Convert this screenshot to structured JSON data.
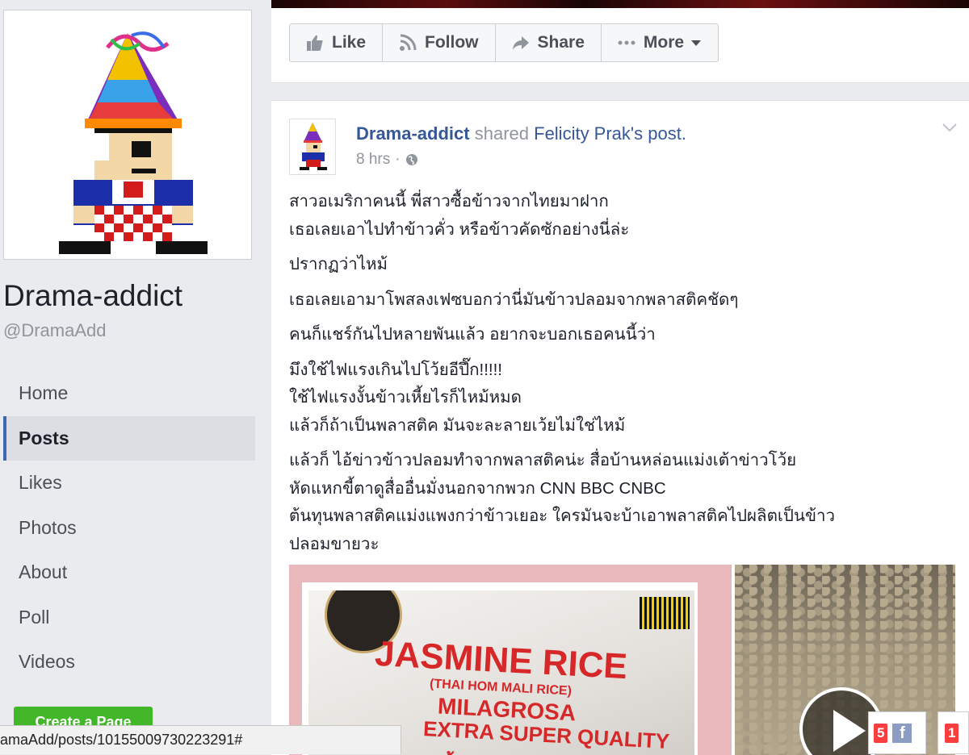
{
  "page": {
    "name": "Drama-addict",
    "handle": "@DramaAdd"
  },
  "nav": {
    "items": [
      {
        "label": "Home",
        "active": false
      },
      {
        "label": "Posts",
        "active": true
      },
      {
        "label": "Likes",
        "active": false
      },
      {
        "label": "Photos",
        "active": false
      },
      {
        "label": "About",
        "active": false
      },
      {
        "label": "Poll",
        "active": false
      },
      {
        "label": "Videos",
        "active": false
      }
    ],
    "create_page_label": "Create a Page"
  },
  "actions": {
    "like": "Like",
    "follow": "Follow",
    "share": "Share",
    "more": "More"
  },
  "post": {
    "author": "Drama-addict",
    "shared_text": "shared",
    "shared_link": "Felicity Prak's post.",
    "time": "8 hrs",
    "paragraphs": [
      [
        "สาวอเมริกาคนนี้ พี่สาวซื้อข้าวจากไทยมาฝาก",
        "เธอเลยเอาไปทำข้าวคั่ว หรือข้าวคัดซักอย่างนี่ล่ะ"
      ],
      [
        "ปรากฏว่าไหม้"
      ],
      [
        "เธอเลยเอามาโพสลงเฟซบอกว่านี่มันข้าวปลอมจากพลาสติคชัดๆ"
      ],
      [
        "คนก็แชร์กันไปหลายพันแล้ว อยากจะบอกเธอคนนี้ว่า"
      ],
      [
        "มึงใช้ไฟแรงเกินไปโว้ยอีปึ๊ก!!!!!",
        "ใช้ไฟแรงงั้นข้าวเหี้ยไรก็ไหม้หมด",
        "แล้วก็ถ้าเป็นพลาสติค มันจะละลายเว้ยไม่ใช่ไหม้"
      ],
      [
        "แล้วก็ ไอ้ข่าวข้าวปลอมทำจากพลาสติคน่ะ สื่อบ้านหล่อนแม่งเต้าข่าวโว้ย",
        "หัดแหกขี้ตาดูสื่ออื่นมั่งนอกจากพวก CNN BBC CNBC",
        "ต้นทุนพลาสติคแม่งแพงกว่าข้าวเยอะ ใครมันจะบ้าเอาพลาสติคไปผลิตเป็นข้าว",
        "ปลอมขายวะ"
      ]
    ],
    "image_text": {
      "line1": "JASMINE RICE",
      "line2": "(THAI HOM MALI RICE)",
      "line3": "MILAGROSA",
      "line4": "EXTRA SUPER QUALITY",
      "line5": "ข้าวหอมมะลิชนิดพิเศษ"
    }
  },
  "status_url": "amaAdd/posts/10155009730223291#",
  "widgets": {
    "badge1": "5",
    "badge2": "1"
  },
  "colors": {
    "accent": "#4267b2",
    "link": "#365899",
    "green": "#42b72a",
    "badge": "#fa3e3e"
  }
}
